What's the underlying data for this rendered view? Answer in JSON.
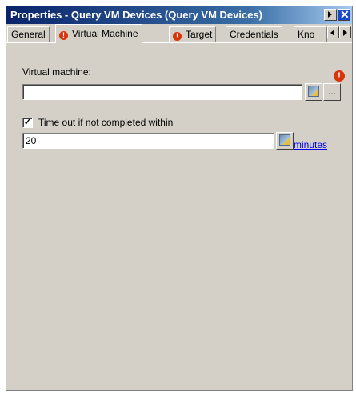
{
  "window": {
    "title": "Properties - Query VM Devices (Query VM Devices)",
    "next_button": "next-icon",
    "close_button": "close-icon"
  },
  "tabs": [
    {
      "label": "General",
      "active": false,
      "error": false
    },
    {
      "label": "Virtual Machine",
      "active": true,
      "error": true
    },
    {
      "label": "Target",
      "active": false,
      "error": true
    },
    {
      "label": "Credentials",
      "active": false,
      "error": false
    },
    {
      "label": "Kno",
      "active": false,
      "error": false
    }
  ],
  "vm": {
    "label": "Virtual machine:",
    "value": "",
    "browse_label": "..."
  },
  "timeout": {
    "checkbox_label": "Time out if not completed within",
    "checked": true,
    "value": "20",
    "units_link": "minutes"
  },
  "icons": {
    "error": "error-icon",
    "picker": "picker-icon"
  },
  "colors": {
    "title_start": "#0a246a",
    "title_end": "#a6caf0",
    "error": "#d9330c",
    "link": "#0000ee",
    "face": "#d4d0c8"
  }
}
